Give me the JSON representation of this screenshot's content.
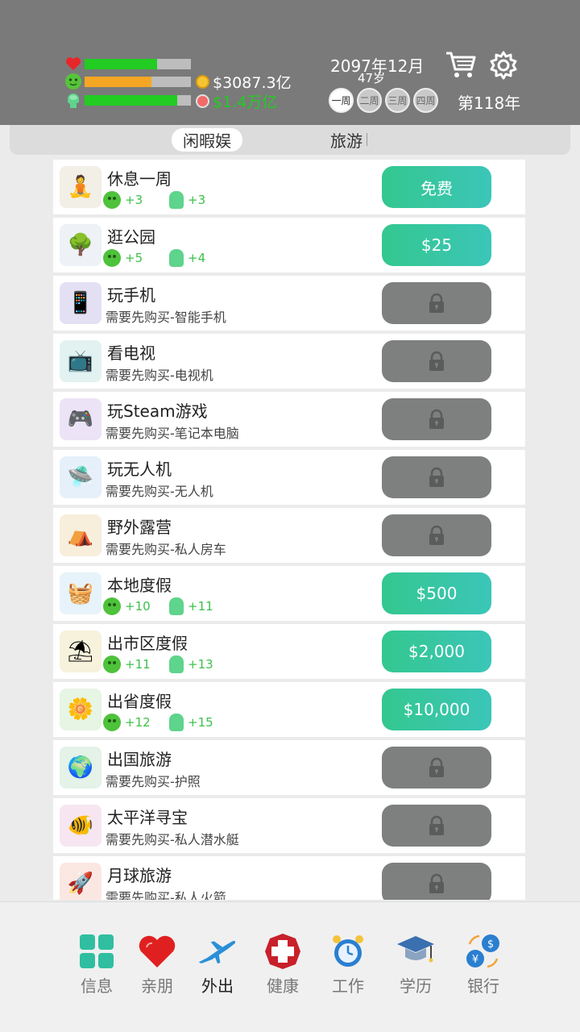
{
  "status": {
    "bars": [
      {
        "name": "health",
        "fill": 0.68,
        "color": "#22cc22"
      },
      {
        "name": "happiness",
        "fill": 0.63,
        "color": "#f5a623"
      },
      {
        "name": "intelligence",
        "fill": 0.87,
        "color": "#22cc22"
      }
    ],
    "money": "$3087.3亿",
    "money_color": "#ffffff",
    "assets": "$1.4万亿",
    "assets_color": "#22cc22",
    "date": "2097年12月",
    "age": "47岁",
    "weeks": [
      "一周",
      "二周",
      "三周",
      "四周"
    ],
    "active_week": 0,
    "year": "第118年"
  },
  "tabs": {
    "leisure": "闲暇娱",
    "travel": "旅游"
  },
  "activities": [
    {
      "title": "休息一周",
      "stat1": "+3",
      "stat2": "+3",
      "button": "免费",
      "locked": false,
      "icon_color": "#f2efe7",
      "emoji": "🧘"
    },
    {
      "title": "逛公园",
      "stat1": "+5",
      "stat2": "+4",
      "button": "$25",
      "locked": false,
      "icon_color": "#eef1f6",
      "emoji": "🌳"
    },
    {
      "title": "玩手机",
      "sub": "需要先购买-智能手机",
      "locked": true,
      "icon_color": "#e4e0f4",
      "emoji": "📱"
    },
    {
      "title": "看电视",
      "sub": "需要先购买-电视机",
      "locked": true,
      "icon_color": "#e2f2f1",
      "emoji": "📺"
    },
    {
      "title": "玩Steam游戏",
      "sub": "需要先购买-笔记本电脑",
      "locked": true,
      "icon_color": "#ece3f7",
      "emoji": "🎮"
    },
    {
      "title": "玩无人机",
      "sub": "需要先购买-无人机",
      "locked": true,
      "icon_color": "#e6f0fa",
      "emoji": "🛸"
    },
    {
      "title": "野外露营",
      "sub": "需要先购买-私人房车",
      "locked": true,
      "icon_color": "#f7efdc",
      "emoji": "⛺"
    },
    {
      "title": "本地度假",
      "stat1": "+10",
      "stat2": "+11",
      "button": "$500",
      "locked": false,
      "icon_color": "#e7f3fa",
      "emoji": "🧺"
    },
    {
      "title": "出市区度假",
      "stat1": "+11",
      "stat2": "+13",
      "button": "$2,000",
      "locked": false,
      "icon_color": "#f6f2dc",
      "emoji": "⛱"
    },
    {
      "title": "出省度假",
      "stat1": "+12",
      "stat2": "+15",
      "button": "$10,000",
      "locked": false,
      "icon_color": "#e6f5e4",
      "emoji": "🌼"
    },
    {
      "title": "出国旅游",
      "sub": "需要先购买-护照",
      "locked": true,
      "icon_color": "#e4f2e7",
      "emoji": "🌍"
    },
    {
      "title": "太平洋寻宝",
      "sub": "需要先购买-私人潜水艇",
      "locked": true,
      "icon_color": "#f7e6f1",
      "emoji": "🐠"
    },
    {
      "title": "月球旅游",
      "sub": "需要先购买-私人火箭",
      "locked": true,
      "icon_color": "#fbe7e2",
      "emoji": "🚀"
    }
  ],
  "nav": [
    {
      "label": "信息",
      "name": "info",
      "color": "#2fbfa0"
    },
    {
      "label": "亲朋",
      "name": "friends",
      "color": "#e02020"
    },
    {
      "label": "外出",
      "name": "outing",
      "color": "#2a8fd8"
    },
    {
      "label": "健康",
      "name": "health",
      "color": "#c8202a"
    },
    {
      "label": "工作",
      "name": "work",
      "color": "#2a7fd0"
    },
    {
      "label": "学历",
      "name": "education",
      "color": "#3a6fb0"
    },
    {
      "label": "银行",
      "name": "bank",
      "color": "#2a7fd0"
    }
  ],
  "active_nav": 2
}
